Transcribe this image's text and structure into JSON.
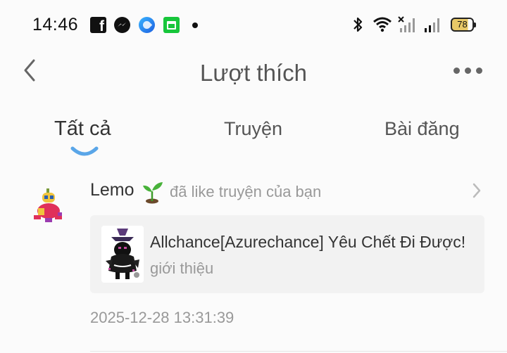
{
  "status_bar": {
    "time": "14:46",
    "battery": "78",
    "icons": [
      "facebook-icon",
      "messenger-icon",
      "app-icon",
      "app-store-icon",
      "notification-dot-icon",
      "bluetooth-icon",
      "wifi-icon",
      "signal-no-sim-icon",
      "signal-icon",
      "battery-icon"
    ]
  },
  "header": {
    "title": "Lượt thích",
    "back_icon": "chevron-left-icon",
    "more_icon": "more-dots-icon"
  },
  "tabs": [
    {
      "label": "Tất cả",
      "active": true
    },
    {
      "label": "Truyện",
      "active": false
    },
    {
      "label": "Bài đăng",
      "active": false
    }
  ],
  "colors": {
    "accent": "#5aa6e8",
    "text_primary": "#333333",
    "text_secondary": "#999999",
    "card_bg": "#f2f2f2",
    "background": "#fbfbfb"
  },
  "notifications": [
    {
      "user_name": "Lemo",
      "user_emoji_icon": "sprout-icon",
      "action": "đã like truyện của bạn",
      "story": {
        "title": "Allchance[Azurechance] Yêu Chết Đi Được!",
        "subtitle": "giới thiệu"
      },
      "timestamp": "2025-12-28 13:31:39"
    }
  ]
}
